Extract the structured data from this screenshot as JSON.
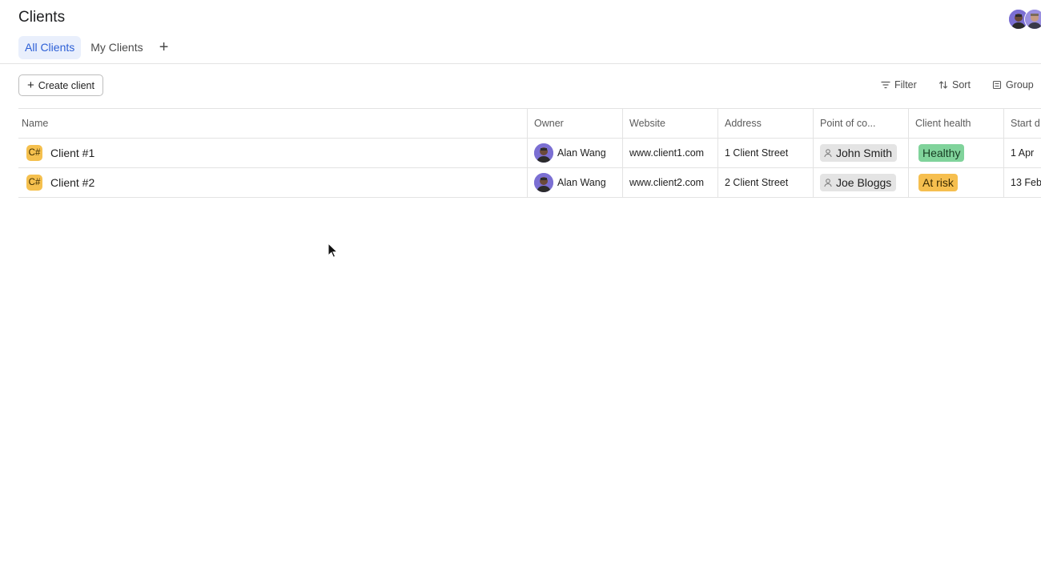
{
  "page": {
    "title": "Clients"
  },
  "tabs": [
    {
      "label": "All Clients",
      "active": true
    },
    {
      "label": "My Clients",
      "active": false
    }
  ],
  "toolbar": {
    "create_label": "Create client",
    "filter_label": "Filter",
    "sort_label": "Sort",
    "group_label": "Group"
  },
  "table": {
    "columns": [
      "Name",
      "Owner",
      "Website",
      "Address",
      "Point of co...",
      "Client health",
      "Start d"
    ],
    "rows": [
      {
        "icon_text": "C#",
        "name": "Client #1",
        "owner": "Alan Wang",
        "website": "www.client1.com",
        "address": "1 Client Street",
        "point_of_contact": "John Smith",
        "health": "Healthy",
        "start": "1 Apr"
      },
      {
        "icon_text": "C#",
        "name": "Client #2",
        "owner": "Alan Wang",
        "website": "www.client2.com",
        "address": "2 Client Street",
        "point_of_contact": "Joe Bloggs",
        "health": "At risk",
        "start": "13 Feb"
      }
    ]
  },
  "colors": {
    "accent": "#2c5fd6",
    "tab_active_bg": "#e9effc",
    "healthy": "#80d39b",
    "at_risk": "#f6bf4f",
    "client_icon": "#f5c04e"
  },
  "icons": {
    "add_tab": "plus-icon",
    "create": "plus-icon",
    "filter": "filter-icon",
    "sort": "sort-icon",
    "group": "group-icon",
    "contact": "person-icon"
  }
}
